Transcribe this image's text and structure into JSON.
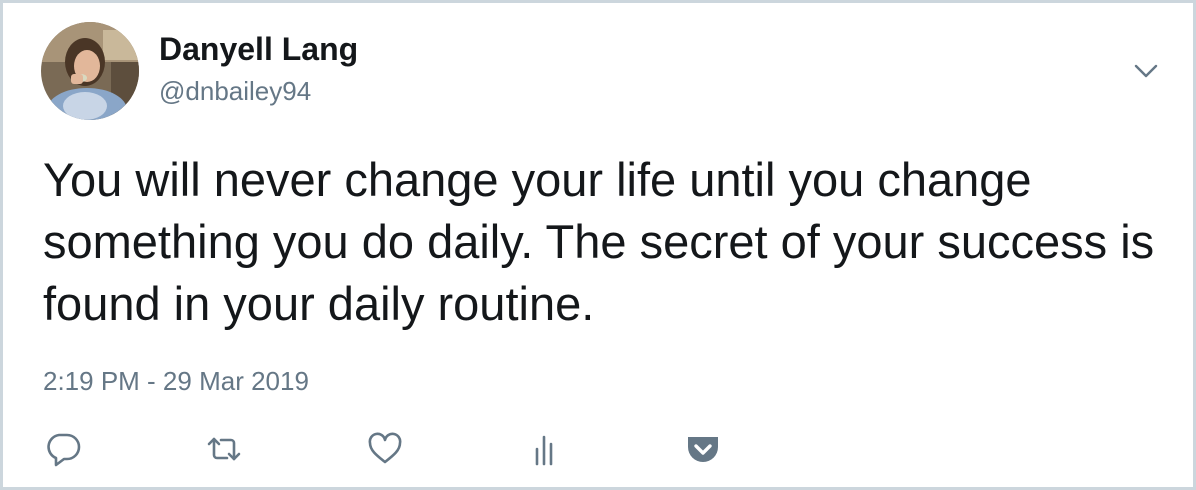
{
  "author": {
    "display_name": "Danyell Lang",
    "handle": "@dnbailey94",
    "avatar": "profile-photo"
  },
  "tweet": {
    "text": "You will never change your life until you change something you do daily. The secret of your success is found in your daily routine.",
    "timestamp": "2:19 PM - 29 Mar 2019"
  },
  "actions": [
    {
      "name": "reply",
      "icon": "reply-icon"
    },
    {
      "name": "retweet",
      "icon": "retweet-icon"
    },
    {
      "name": "like",
      "icon": "heart-icon"
    },
    {
      "name": "analytics",
      "icon": "analytics-icon"
    },
    {
      "name": "pocket",
      "icon": "pocket-icon"
    }
  ],
  "colors": {
    "text_primary": "#14171a",
    "text_secondary": "#657786",
    "icon": "#657786",
    "border": "#ccd6dd"
  }
}
